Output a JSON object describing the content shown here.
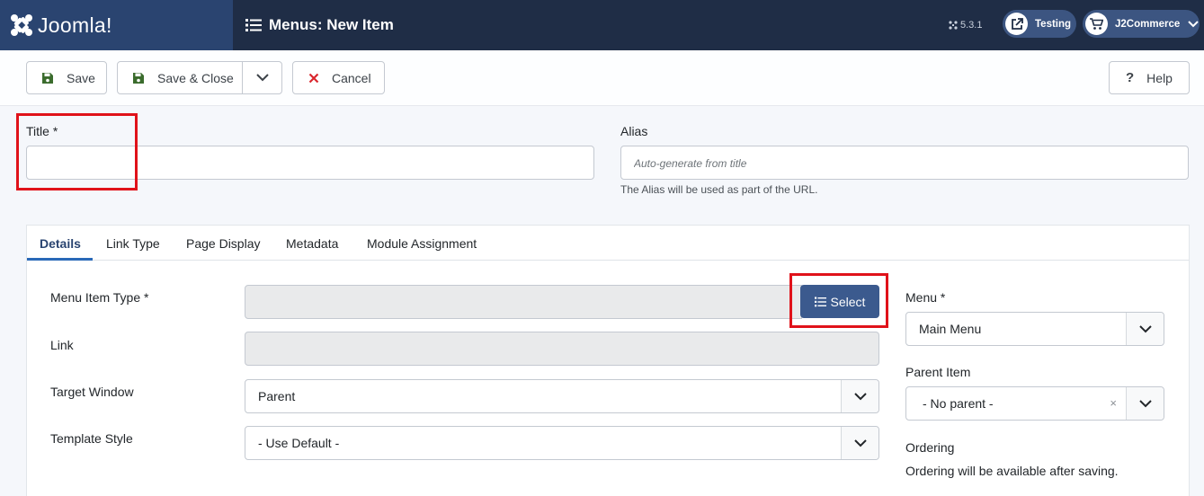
{
  "header": {
    "brand": "Joomla!",
    "title": "Menus: New Item",
    "version": "5.3.1",
    "site_link": "Testing",
    "user_menu": "J2Commerce"
  },
  "toolbar": {
    "save": "Save",
    "save_close": "Save & Close",
    "cancel": "Cancel",
    "help": "Help"
  },
  "form": {
    "title_label": "Title *",
    "title_value": "",
    "alias_label": "Alias",
    "alias_placeholder": "Auto-generate from title",
    "alias_hint": "The Alias will be used as part of the URL."
  },
  "tabs": [
    "Details",
    "Link Type",
    "Page Display",
    "Metadata",
    "Module Assignment"
  ],
  "details": {
    "menu_item_type_label": "Menu Item Type *",
    "select_button": "Select",
    "link_label": "Link",
    "target_window_label": "Target Window",
    "target_window_value": "Parent",
    "template_style_label": "Template Style",
    "template_style_value": "- Use Default -"
  },
  "sidebar": {
    "menu_label": "Menu *",
    "menu_value": "Main Menu",
    "parent_label": "Parent Item",
    "parent_value": "- No parent -",
    "parent_clear": "×",
    "ordering_label": "Ordering",
    "ordering_text": "Ordering will be available after saving."
  },
  "colors": {
    "header_bg": "#1f2d46",
    "logo_bg": "#2a4470",
    "select_button_bg": "#3b5a8e",
    "highlight_red": "#e0121a",
    "cancel_icon": "#d9262d",
    "save_icon": "#3b6c2d"
  },
  "icons": {
    "brand": "joomla-logo-icon",
    "title": "list-icon",
    "version": "joomla-small-icon",
    "site_link": "external-link-icon",
    "user_menu": "cart-icon",
    "save": "floppy-icon",
    "cancel": "x-icon",
    "help": "question-icon",
    "select": "list-icon"
  }
}
